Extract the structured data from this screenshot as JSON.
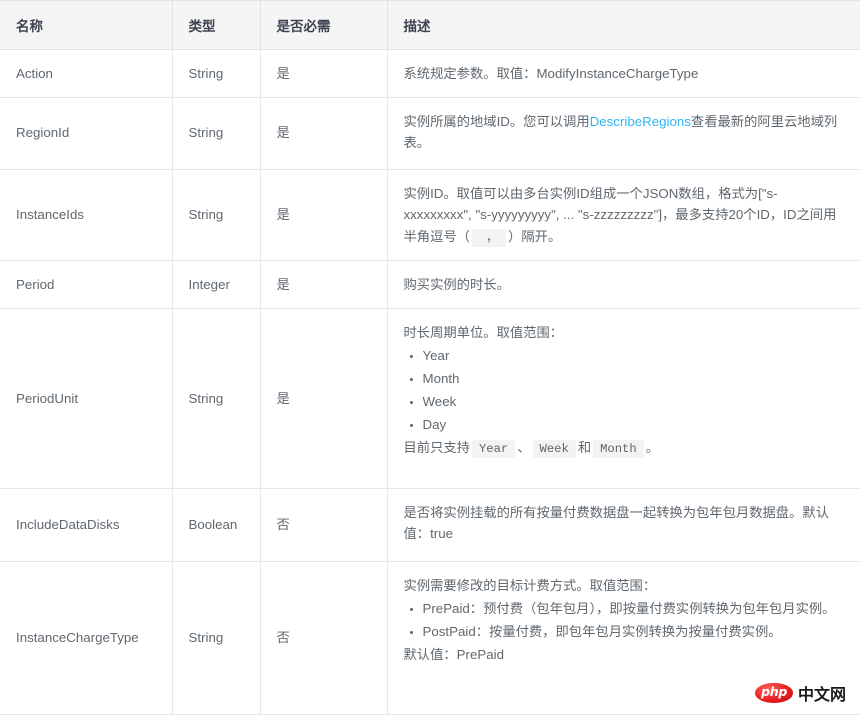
{
  "table": {
    "headers": [
      "名称",
      "类型",
      "是否必需",
      "描述"
    ],
    "rows": [
      {
        "name": "Action",
        "type": "String",
        "required": "是",
        "desc_intro": "系统规定参数。取值：ModifyInstanceChargeType"
      },
      {
        "name": "RegionId",
        "type": "String",
        "required": "是",
        "desc_pre": "实例所属的地域ID。您可以调用",
        "desc_link": "DescribeRegions",
        "desc_post": "查看最新的阿里云地域列表。"
      },
      {
        "name": "InstanceIds",
        "type": "String",
        "required": "是",
        "desc_pre": "实例ID。取值可以由多台实例ID组成一个JSON数组，格式为[\"s-xxxxxxxxx\", \"s-yyyyyyyyy\", ... \"s-zzzzzzzzz\"]，最多支持20个ID，ID之间用半角逗号（",
        "desc_code": "，",
        "desc_post": "）隔开。"
      },
      {
        "name": "Period",
        "type": "Integer",
        "required": "是",
        "desc_intro": "购买实例的时长。"
      },
      {
        "name": "PeriodUnit",
        "type": "String",
        "required": "是",
        "desc_intro": "时长周期单位。取值范围：",
        "bullets": [
          "Year",
          "Month",
          "Week",
          "Day"
        ],
        "note_pre": "目前只支持",
        "note_code1": "Year",
        "note_sep1": "、",
        "note_code2": "Week",
        "note_sep2": "和",
        "note_code3": "Month",
        "note_end": "。"
      },
      {
        "name": "IncludeDataDisks",
        "type": "Boolean",
        "required": "否",
        "desc_intro": "是否将实例挂载的所有按量付费数据盘一起转换为包年包月数据盘。默认值：true"
      },
      {
        "name": "InstanceChargeType",
        "type": "String",
        "required": "否",
        "desc_intro": "实例需要修改的目标计费方式。取值范围：",
        "bullets": [
          "PrePaid：预付费（包年包月），即按量付费实例转换为包年包月实例。",
          "PostPaid：按量付费，即包年包月实例转换为按量付费实例。"
        ],
        "note_plain": "默认值：PrePaid"
      }
    ]
  },
  "watermark": {
    "badge": "php",
    "text": "中文网"
  },
  "colors": {
    "link": "#2db7f5",
    "header_bg": "#f5f5f5",
    "border": "#e8e8e8",
    "text": "#5b646c",
    "watermark_badge": "#e81f1f"
  }
}
